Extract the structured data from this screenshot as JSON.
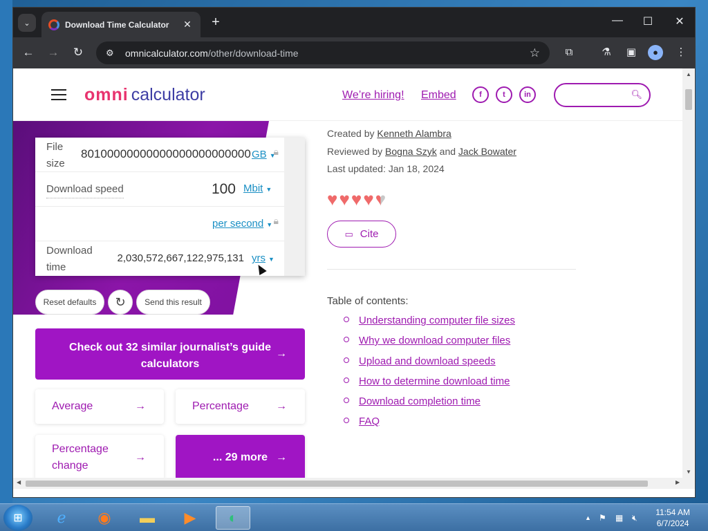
{
  "browser": {
    "tab_title": "Download Time Calculator",
    "url_host": "omnicalculator.com",
    "url_path": "/other/download-time"
  },
  "header": {
    "logo_mark": "omni",
    "logo_text": "calculator",
    "hiring": "We’re hiring!",
    "embed": "Embed",
    "social": [
      "f",
      "t",
      "in"
    ]
  },
  "calculator": {
    "file_size_label": "File size",
    "file_size_value": "80100000000000000000000000",
    "file_size_unit": "GB",
    "download_speed_label": "Download speed",
    "download_speed_value": "100",
    "download_speed_unit": "Mbit",
    "per_unit": "per second",
    "download_time_label": "Download time",
    "download_time_value": "2,030,572,667,122,975,131",
    "download_time_unit": "yrs"
  },
  "actions": {
    "reset": "Reset defaults",
    "send": "Send this result"
  },
  "cta": {
    "similar": "Check out 32 similar journalist’s guide calculators",
    "chips": [
      "Average",
      "Percentage",
      "Percentage change"
    ],
    "more": "... 29 more"
  },
  "meta": {
    "created_prefix": "Created by",
    "created_by": "Kenneth Alambra",
    "reviewed_prefix": "Reviewed by",
    "reviewer1": "Bogna Szyk",
    "and": "and",
    "reviewer2": "Jack Bowater",
    "updated": "Last updated: Jan 18, 2024",
    "rating_hearts": 4.5
  },
  "cite": "Cite",
  "toc": {
    "title": "Table of contents:",
    "items": [
      "Understanding computer file sizes",
      "Why we download computer files",
      "Upload and download speeds",
      "How to determine download time",
      "Download completion time",
      "FAQ"
    ]
  },
  "taskbar": {
    "time": "11:54 AM",
    "date": "6/7/2024"
  },
  "colors": {
    "brand_purple": "#9e1ab0",
    "cta_purple": "#a015c4",
    "heart": "#ef6a6a",
    "unit_blue": "#1a8fc4"
  }
}
